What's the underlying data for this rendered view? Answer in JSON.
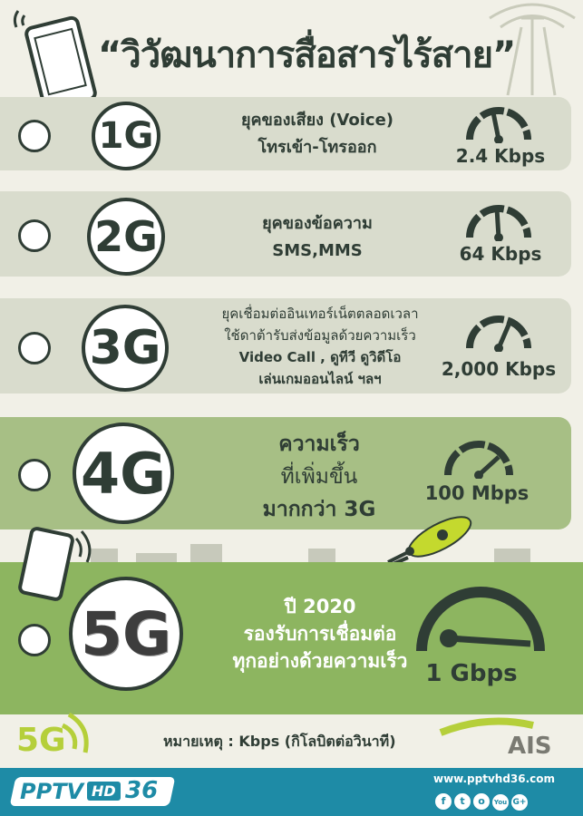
{
  "title": "“วิวัฒนาการสื่อสารไร้สาย”",
  "generations": [
    {
      "badge": "1G",
      "lines": [
        "ยุคของเสียง (Voice)",
        "โทรเข้า-โทรออก"
      ],
      "speed": "2.4 Kbps"
    },
    {
      "badge": "2G",
      "lines": [
        "ยุคของข้อความ",
        "SMS,MMS"
      ],
      "speed": "64 Kbps"
    },
    {
      "badge": "3G",
      "lines": [
        "ยุคเชื่อมต่ออินเทอร์เน็ตตลอดเวลา",
        "ใช้ดาต้ารับส่งข้อมูลด้วยความเร็ว",
        "Video Call , ดูทีวี ดูวิดีโอ",
        "เล่นเกมออนไลน์ ฯลฯ"
      ],
      "speed": "2,000 Kbps"
    },
    {
      "badge": "4G",
      "lines": [
        "ความเร็ว",
        "ที่เพิ่มขึ้น",
        "มากกว่า 3G"
      ],
      "speed": "100 Mbps"
    },
    {
      "badge": "5G",
      "lines": [
        "ปี 2020",
        "รองรับการเชื่อมต่อ",
        "ทุกอย่างด้วยความเร็ว"
      ],
      "speed": "1 Gbps"
    }
  ],
  "note": "หมายเหตุ : Kbps (กิโลบิตต่อวินาที)",
  "logo_5g": "5G",
  "brand_ais": "AIS",
  "pptv_logo": "PPTV",
  "pptv_hd": "HD",
  "pptv_channel": "36",
  "website": "www.pptvhd36.com",
  "social_icons": [
    "f",
    "t",
    "o",
    "You",
    "G+"
  ],
  "colors": {
    "dark": "#2f3d35",
    "row_light": "#d9dccd",
    "row_green": "#a7bf85",
    "row_5g": "#8db560",
    "footer": "#1e8ba6",
    "accent": "#b5cf3a"
  }
}
